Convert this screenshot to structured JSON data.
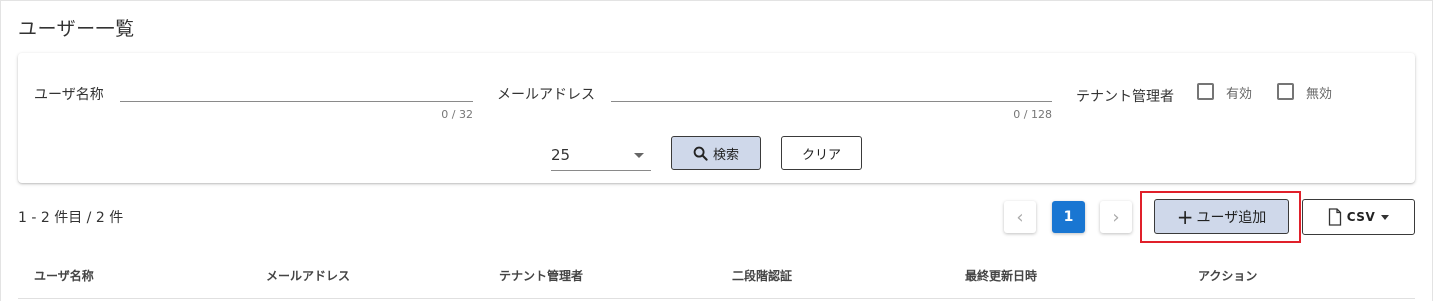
{
  "page": {
    "title": "ユーザー一覧"
  },
  "search": {
    "username_label": "ユーザ名称",
    "username_counter": "0 / 32",
    "email_label": "メールアドレス",
    "email_counter": "0 / 128",
    "tenant_admin_label": "テナント管理者",
    "enabled_label": "有効",
    "disabled_label": "無効",
    "page_size": "25",
    "search_button": "検索",
    "clear_button": "クリア"
  },
  "results": {
    "count_text": "1 - 2 件目 / 2 件"
  },
  "pagination": {
    "current_page": "1",
    "prev": "‹",
    "next": "›"
  },
  "actions": {
    "add_user": "ユーザ追加",
    "add_icon": "+",
    "csv": "CSV"
  },
  "table": {
    "columns": [
      "ユーザ名称",
      "メールアドレス",
      "テナント管理者",
      "二段階認証",
      "最終更新日時",
      "アクション"
    ]
  },
  "colors": {
    "primary": "#1976d2",
    "button_bg": "#cfd8ea",
    "highlight": "#e0202a"
  }
}
